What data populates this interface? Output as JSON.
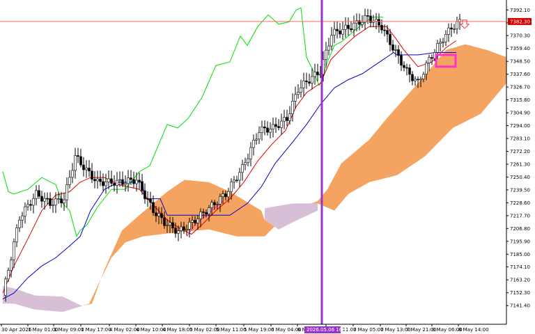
{
  "chart_data": {
    "type": "candlestick",
    "indicator": "Ichimoku Kinko Hyo",
    "grid": false,
    "ylim": [
      7135.0,
      7397.0
    ],
    "price_ticks": [
      "7392.10",
      "7381.20",
      "7370.30",
      "7359.40",
      "7348.50",
      "7337.60",
      "7326.70",
      "7315.80",
      "7304.90",
      "7294.00",
      "7283.10",
      "7272.20",
      "7261.30",
      "7250.40",
      "7239.50",
      "7228.60",
      "7217.70",
      "7206.80",
      "7195.90",
      "7185.00",
      "7174.10",
      "7163.20",
      "7152.30",
      "7141.40"
    ],
    "time_labels": [
      "30 Apr 2026",
      "1 May 01:00",
      "1 May 09:00",
      "1 May 17:00",
      "4 May 02:00",
      "4 May 10:00",
      "4 May 18:00",
      "5 May 02:00",
      "5 May 11:00",
      "5 May 19:00",
      "6 May 04:00",
      "6 May 12:00",
      "6 May 21:00",
      "7 May 05:00",
      "7 May 13:00",
      "7 May 21:00",
      "8 May 06:00",
      "8 May 14:00"
    ],
    "current_price": "7382.30",
    "highlighted_time": "2026.05.06 16:00",
    "colors": {
      "tenkan": "#e00000",
      "kijun": "#0000cc",
      "chikou": "#00e000",
      "kumo_bull": "#f4a460",
      "kumo_bear": "#d8bfd8",
      "vline": "#9933cc",
      "price_line": "#ff6666",
      "price_tag": "#d00000",
      "marker": "#ff33cc",
      "arrow": "#ff3333"
    }
  }
}
